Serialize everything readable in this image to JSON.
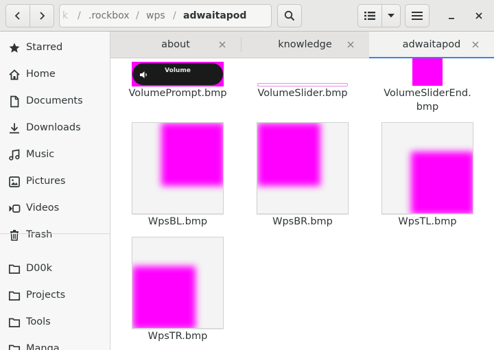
{
  "header": {
    "back_icon": "chevron-left-icon",
    "forward_icon": "chevron-right-icon",
    "path": [
      ".rockbox",
      "wps",
      "adwaitapod"
    ],
    "path_partial": "k",
    "path_separator": "/",
    "path_menu_icon": "vertical-ellipsis-icon",
    "search_icon": "search-icon",
    "view_icon": "list-view-icon",
    "view_options_icon": "chevron-down-icon",
    "menu_icon": "hamburger-menu-icon",
    "minimize_icon": "minimize-icon",
    "close_icon": "close-icon"
  },
  "sidebar": {
    "items": [
      {
        "label": "Starred",
        "icon": "star-icon"
      },
      {
        "label": "Home",
        "icon": "home-icon"
      },
      {
        "label": "Documents",
        "icon": "document-icon"
      },
      {
        "label": "Downloads",
        "icon": "download-icon"
      },
      {
        "label": "Music",
        "icon": "music-icon"
      },
      {
        "label": "Pictures",
        "icon": "picture-icon"
      },
      {
        "label": "Videos",
        "icon": "video-icon"
      },
      {
        "label": "Trash",
        "icon": "trash-icon"
      },
      {
        "label": "D00k",
        "icon": "folder-icon"
      },
      {
        "label": "Projects",
        "icon": "folder-icon"
      },
      {
        "label": "Tools",
        "icon": "folder-icon"
      },
      {
        "label": "Manga",
        "icon": "folder-icon"
      }
    ]
  },
  "tabs": [
    {
      "label": "about",
      "active": false
    },
    {
      "label": "knowledge",
      "active": false
    },
    {
      "label": "adwaitapod",
      "active": true
    }
  ],
  "files": [
    {
      "name": "VolumePrompt.bmp",
      "overlay_text": "Volume"
    },
    {
      "name": "VolumeSlider.bmp"
    },
    {
      "name": "VolumeSliderEnd.\nbmp"
    },
    {
      "name": "WpsBL.bmp"
    },
    {
      "name": "WpsBR.bmp"
    },
    {
      "name": "WpsTL.bmp"
    },
    {
      "name": "WpsTR.bmp"
    }
  ],
  "colors": {
    "accent": "#3584e4",
    "thumbnail_magenta": "#ff00ff"
  }
}
